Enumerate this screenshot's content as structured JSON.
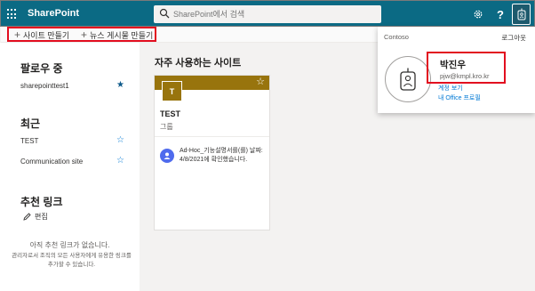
{
  "suite": {
    "app_name": "SharePoint",
    "search_placeholder": "SharePoint에서 검색"
  },
  "commands": {
    "create_site": "사이트 만들기",
    "create_news": "뉴스 게시물 만들기"
  },
  "following": {
    "title": "팔로우 중",
    "items": [
      {
        "label": "sharepointtest1",
        "starred": true
      }
    ]
  },
  "recent": {
    "title": "최근",
    "items": [
      {
        "label": "TEST",
        "starred": false
      },
      {
        "label": "Communication site",
        "starred": false
      }
    ]
  },
  "suggested": {
    "title": "추천 링크",
    "edit_label": "편집",
    "empty_title": "아직 추천 링크가 없습니다.",
    "empty_desc": "관리자로서 조직의 모든 사용자에게 유용한 링크를 추가할 수 있습니다."
  },
  "frequent": {
    "title": "자주 사용하는 사이트",
    "card": {
      "logo_letter": "T",
      "name": "TEST",
      "type": "그룹",
      "activity": "Ad-Hoc_기능설명서를(를) 날짜: 4/8/2021에 확인했습니다."
    }
  },
  "account_panel": {
    "org": "Contoso",
    "sign_out": "로그아웃",
    "user_name": "박진우",
    "email": "pjw@kmpl.kro.kr",
    "link_account": "계정 보기",
    "link_profile": "내 Office 프로필"
  },
  "colors": {
    "suite_bar": "#0b6a84",
    "card_banner": "#98740d",
    "highlight": "#e20d1f",
    "link": "#0078d4"
  }
}
